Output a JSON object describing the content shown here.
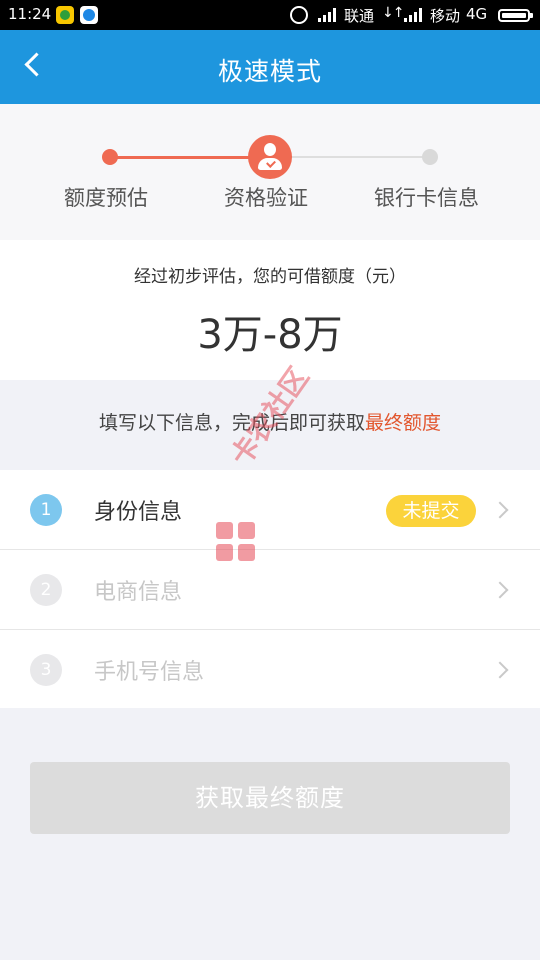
{
  "status_bar": {
    "time": "11:24",
    "carrier1": "联通",
    "data_indicator": "↓↑",
    "carrier2": "移动",
    "network": "4G"
  },
  "header": {
    "title": "极速模式"
  },
  "stepper": {
    "steps": [
      {
        "label": "额度预估",
        "state": "done"
      },
      {
        "label": "资格验证",
        "state": "current"
      },
      {
        "label": "银行卡信息",
        "state": "todo"
      }
    ]
  },
  "amount": {
    "description": "经过初步评估，您的可借额度（元）",
    "value": "3万-8万"
  },
  "hint": {
    "prefix": "填写以下信息，完成后即可获取",
    "emphasis": "最终额度"
  },
  "list": {
    "items": [
      {
        "number": "1",
        "label": "身份信息",
        "badge": "未提交"
      },
      {
        "number": "2",
        "label": "电商信息"
      },
      {
        "number": "3",
        "label": "手机号信息"
      }
    ]
  },
  "watermark": {
    "text": "卡农社区"
  },
  "submit": {
    "label": "获取最终额度"
  },
  "colors": {
    "header": "#1e96de",
    "accent": "#ef6a52",
    "hint_emphasis": "#e2562e",
    "badge": "#fbd33b",
    "button_disabled": "#dcdcdc"
  }
}
